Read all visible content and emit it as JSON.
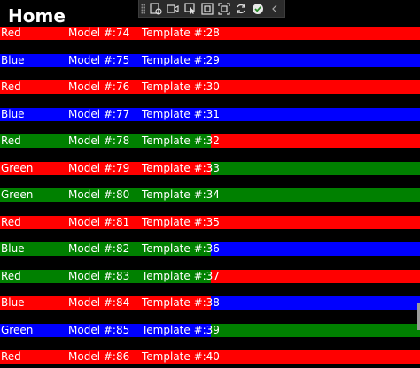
{
  "page": {
    "title": "Home"
  },
  "toolbar": {
    "buttons": [
      {
        "name": "live-visual-tree-icon"
      },
      {
        "name": "record-video-icon"
      },
      {
        "name": "select-element-icon"
      },
      {
        "name": "display-layout-adorners-icon"
      },
      {
        "name": "track-focus-icon"
      },
      {
        "name": "hot-reload-icon"
      },
      {
        "name": "status-ok-icon"
      },
      {
        "name": "collapse-chevron-icon"
      }
    ]
  },
  "colors": {
    "Red": "#ff0000",
    "Blue": "#0000ff",
    "Green": "#008000"
  },
  "rows": [
    {
      "color_label": "Red",
      "model": "Model #:74",
      "template": "Template #:28",
      "right_color": "Red"
    },
    {
      "color_label": "Blue",
      "model": "Model #:75",
      "template": "Template #:29",
      "right_color": "Blue"
    },
    {
      "color_label": "Red",
      "model": "Model #:76",
      "template": "Template #:30",
      "right_color": "Red"
    },
    {
      "color_label": "Blue",
      "model": "Model #:77",
      "template": "Template #:31",
      "right_color": "Blue"
    },
    {
      "color_label": "Red",
      "model": "Model #:78",
      "template": "Template #:32",
      "left_color": "Green",
      "right_color": "Red"
    },
    {
      "color_label": "Green",
      "model": "Model #:79",
      "template": "Template #:33",
      "left_color": "Red",
      "right_color": "Green"
    },
    {
      "color_label": "Green",
      "model": "Model #:80",
      "template": "Template #:34",
      "right_color": "Green"
    },
    {
      "color_label": "Red",
      "model": "Model #:81",
      "template": "Template #:35",
      "right_color": "Red"
    },
    {
      "color_label": "Blue",
      "model": "Model #:82",
      "template": "Template #:36",
      "left_color": "Green",
      "right_color": "Blue"
    },
    {
      "color_label": "Red",
      "model": "Model #:83",
      "template": "Template #:37",
      "left_color": "Green",
      "right_color": "Red"
    },
    {
      "color_label": "Blue",
      "model": "Model #:84",
      "template": "Template #:38",
      "left_color": "Red",
      "right_color": "Blue"
    },
    {
      "color_label": "Green",
      "model": "Model #:85",
      "template": "Template #:39",
      "left_color": "Blue",
      "right_color": "Green"
    },
    {
      "color_label": "Red",
      "model": "Model #:86",
      "template": "Template #:40",
      "right_color": "Red"
    }
  ]
}
